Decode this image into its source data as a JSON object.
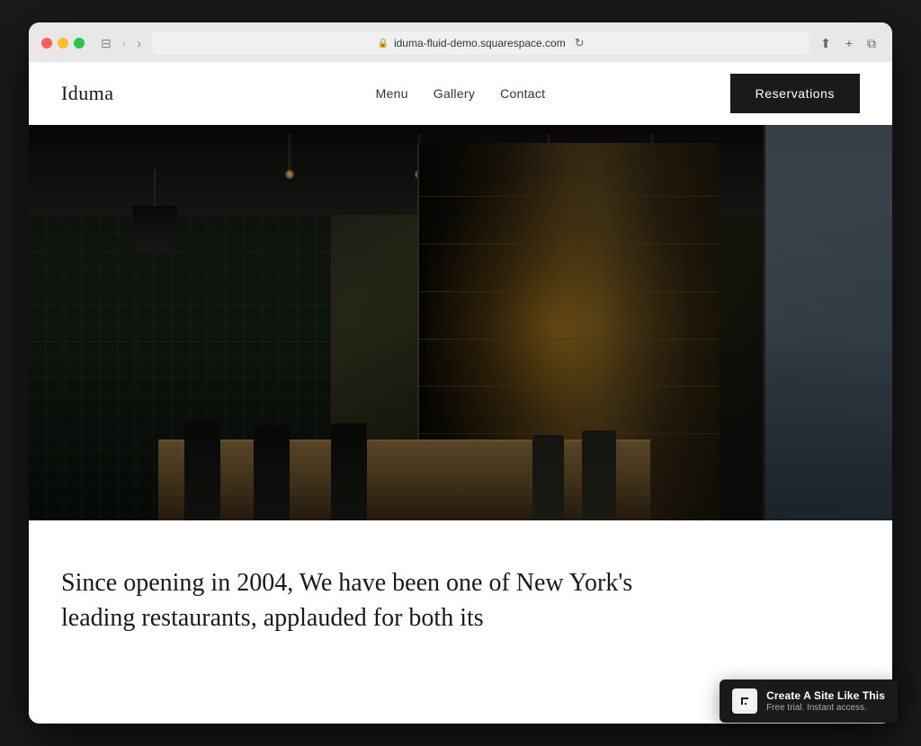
{
  "browser": {
    "url": "iduma-fluid-demo.squarespace.com",
    "reload_icon": "↻",
    "back_icon": "‹",
    "forward_icon": "›",
    "share_icon": "⬆",
    "add_tab_icon": "+",
    "tabs_icon": "⧉",
    "sidebar_icon": "⊟"
  },
  "site": {
    "logo": "Iduma",
    "nav": {
      "links": [
        {
          "label": "Menu",
          "href": "#"
        },
        {
          "label": "Gallery",
          "href": "#"
        },
        {
          "label": "Contact",
          "href": "#"
        }
      ]
    },
    "reservations_btn": "Reservations",
    "hero": {
      "alt": "Restaurant interior with wine rack and dining tables"
    },
    "body_text": "Since opening in 2004, We have been one of New York's leading restaurants, applauded for both its"
  },
  "badge": {
    "title": "Create A Site Like This",
    "subtitle": "Free trial. Instant access."
  }
}
